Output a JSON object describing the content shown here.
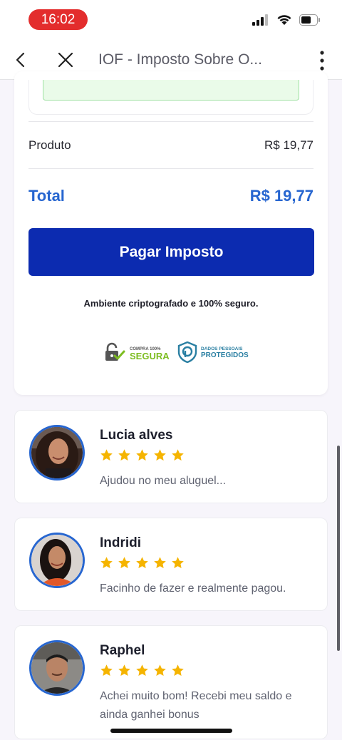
{
  "status_bar": {
    "time": "16:02"
  },
  "nav": {
    "title": "IOF - Imposto Sobre O..."
  },
  "summary": {
    "product_label": "Produto",
    "product_value": "R$ 19,77",
    "total_label": "Total",
    "total_value": "R$ 19,77"
  },
  "pay_button_label": "Pagar Imposto",
  "secure_text": "Ambiente criptografado e 100% seguro.",
  "badges": {
    "compra_small": "COMPRA 100%",
    "compra_big": "SEGURA",
    "dados_line1": "DADOS PESSOAIS",
    "dados_line2": "PROTEGIDOS"
  },
  "colors": {
    "accent": "#2766d0",
    "button": "#0c2bb0",
    "star": "#f5b400",
    "status_pill": "#e32d2d"
  },
  "reviews": [
    {
      "name": "Lucia alves",
      "rating": 5,
      "text": "Ajudou no meu aluguel..."
    },
    {
      "name": "Indridi",
      "rating": 5,
      "text": "Facinho de fazer e realmente pagou."
    },
    {
      "name": "Raphel",
      "rating": 5,
      "text": "Achei muito bom! Recebi meu saldo e ainda ganhei bonus"
    }
  ]
}
